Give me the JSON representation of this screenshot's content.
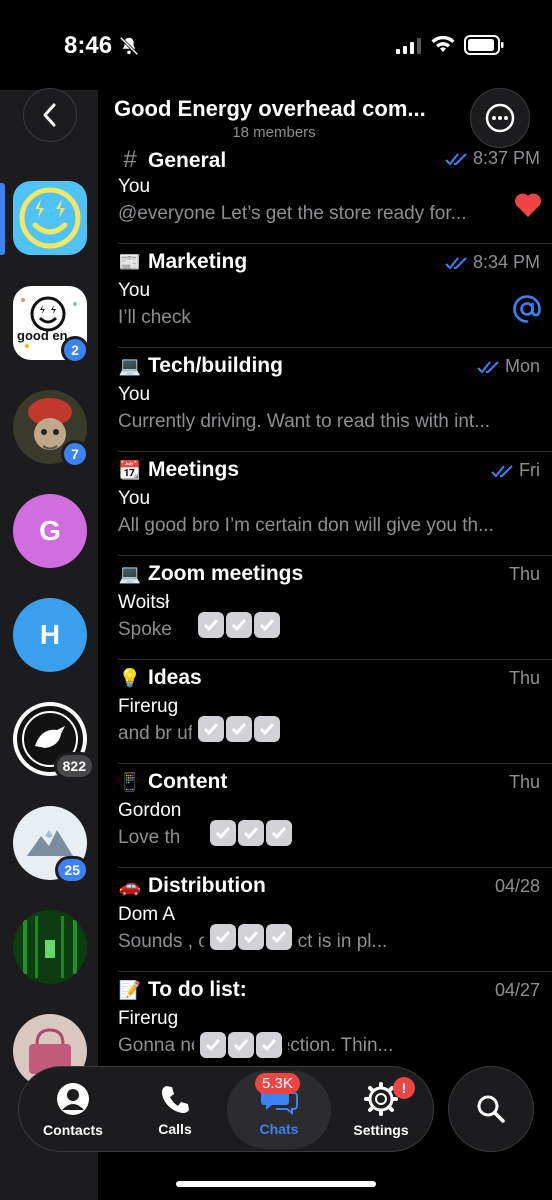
{
  "status_bar": {
    "time": "8:46"
  },
  "header": {
    "title": "Good Energy overhead com...",
    "subtitle": "18 members"
  },
  "rail": {
    "items": [
      {
        "type": "smiley",
        "color": "#4fc3f7",
        "badge": ""
      },
      {
        "type": "brand",
        "badge": "2",
        "text": "good en"
      },
      {
        "type": "photo",
        "color": "#c0392b",
        "badge": "7"
      },
      {
        "type": "letter",
        "letter": "G",
        "color": "#d06ee0",
        "badge": ""
      },
      {
        "type": "letter",
        "letter": "H",
        "color": "#3b9ff0",
        "badge": ""
      },
      {
        "type": "bird",
        "badge": "822"
      },
      {
        "type": "mountain",
        "badge": "25"
      },
      {
        "type": "forest",
        "badge": ""
      },
      {
        "type": "bag",
        "badge": ""
      }
    ]
  },
  "topics": [
    {
      "emoji": "#",
      "title": "General",
      "time": "8:37 PM",
      "read": true,
      "sender": "You",
      "preview": "@everyone Let’s get the store ready for...",
      "status": "heart"
    },
    {
      "emoji": "📰",
      "title": "Marketing",
      "time": "8:34 PM",
      "read": true,
      "sender": "You",
      "preview": "I’ll check",
      "status": "mention"
    },
    {
      "emoji": "💻",
      "title": "Tech/building",
      "time": "Mon",
      "read": true,
      "sender": "You",
      "preview": "Currently driving. Want to read this with int...",
      "status": ""
    },
    {
      "emoji": "📆",
      "title": "Meetings",
      "time": "Fri",
      "read": true,
      "sender": "You",
      "preview": "All good bro I’m certain don will give you th...",
      "status": ""
    },
    {
      "emoji": "💻",
      "title": "Zoom meetings",
      "time": "Thu",
      "read": false,
      "sender": "Woitsł",
      "preview": "Spoke",
      "status": ""
    },
    {
      "emoji": "💡",
      "title": "Ideas",
      "time": "Thu",
      "read": false,
      "sender": "Firerug",
      "preview": "and br                          uff",
      "status": ""
    },
    {
      "emoji": "📱",
      "title": "Content",
      "time": "Thu",
      "read": false,
      "sender": "Gordon",
      "preview": "Love th",
      "status": ""
    },
    {
      "emoji": "🚗",
      "title": "Distribution",
      "time": "04/28",
      "read": false,
      "sender": "Dom A",
      "preview": "Sounds                          , once contract is in pl...",
      "status": ""
    },
    {
      "emoji": "📝",
      "title": "To do list:",
      "time": "04/27",
      "read": false,
      "sender": "Firerug",
      "preview": "Gonna                           ne update section. Thin...",
      "status": ""
    }
  ],
  "tabs": [
    {
      "label": "Contacts",
      "icon": "person-icon",
      "badge": ""
    },
    {
      "label": "Calls",
      "icon": "phone-icon",
      "badge": ""
    },
    {
      "label": "Chats",
      "icon": "chat-icon",
      "badge": "5.3K"
    },
    {
      "label": "Settings",
      "icon": "gear-icon",
      "badge": "!"
    }
  ],
  "colors": {
    "accent": "#3b82f6",
    "badge_red": "#ef4444",
    "heart": "#ef4444"
  }
}
